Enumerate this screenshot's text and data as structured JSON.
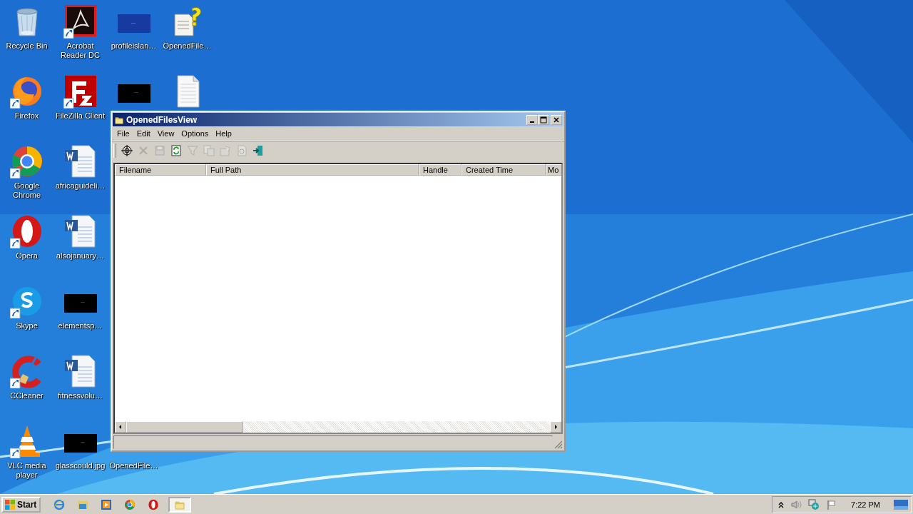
{
  "desktop": {
    "columns": [
      [
        {
          "kind": "recycle",
          "label": "Recycle Bin",
          "shortcut": false
        },
        {
          "kind": "firefox",
          "label": "Firefox",
          "shortcut": true
        },
        {
          "kind": "chrome",
          "label": "Google Chrome",
          "shortcut": true
        },
        {
          "kind": "opera",
          "label": "Opera",
          "shortcut": true
        },
        {
          "kind": "skype",
          "label": "Skype",
          "shortcut": true
        },
        {
          "kind": "ccleaner",
          "label": "CCleaner",
          "shortcut": true
        },
        {
          "kind": "vlc",
          "label": "VLC media player",
          "shortcut": true
        }
      ],
      [
        {
          "kind": "acrobat",
          "label": "Acrobat Reader DC",
          "shortcut": true
        },
        {
          "kind": "filezilla",
          "label": "FileZilla Client",
          "shortcut": true
        },
        {
          "kind": "word",
          "label": "africaguideli…",
          "shortcut": false
        },
        {
          "kind": "word",
          "label": "alsojanuary…",
          "shortcut": false
        },
        {
          "kind": "black",
          "label": "elementsp…",
          "shortcut": false
        },
        {
          "kind": "word",
          "label": "fitnessvolu…",
          "shortcut": false
        },
        {
          "kind": "black",
          "label": "glasscould.jpg",
          "shortcut": false
        }
      ],
      [
        {
          "kind": "navy",
          "label": "profileislan…",
          "shortcut": false
        },
        {
          "kind": "black",
          "shortcut": false
        },
        {
          "kind": "empty"
        },
        {
          "kind": "empty"
        },
        {
          "kind": "empty"
        },
        {
          "kind": "empty"
        },
        {
          "kind": "covered",
          "label": "OpenedFile…"
        }
      ],
      [
        {
          "kind": "helpdoc",
          "label": "OpenedFile…",
          "shortcut": false
        },
        {
          "kind": "textdoc",
          "shortcut": false
        }
      ]
    ]
  },
  "window": {
    "title": "OpenedFilesView",
    "menu": [
      "File",
      "Edit",
      "View",
      "Options",
      "Help"
    ],
    "toolbar": [
      {
        "kind": "target",
        "disabled": false
      },
      {
        "kind": "delete",
        "disabled": true
      },
      {
        "kind": "save",
        "disabled": true
      },
      {
        "kind": "refresh",
        "disabled": false
      },
      {
        "kind": "filter",
        "disabled": true
      },
      {
        "kind": "copy",
        "disabled": true
      },
      {
        "kind": "properties",
        "disabled": true
      },
      {
        "kind": "report",
        "disabled": true
      },
      {
        "kind": "exit",
        "disabled": false
      }
    ],
    "table": {
      "columns": [
        "Filename",
        "Full Path",
        "Handle",
        "Created Time",
        "Mo"
      ]
    }
  },
  "taskbar": {
    "start": "Start",
    "apps": [
      {
        "kind": "ie",
        "selected": false
      },
      {
        "kind": "explorer",
        "selected": false
      },
      {
        "kind": "media",
        "selected": false
      },
      {
        "kind": "chrome",
        "selected": false
      },
      {
        "kind": "opera",
        "selected": false
      },
      {
        "kind": "folder",
        "selected": true
      }
    ],
    "tray": {
      "time": "7:22 PM"
    }
  }
}
